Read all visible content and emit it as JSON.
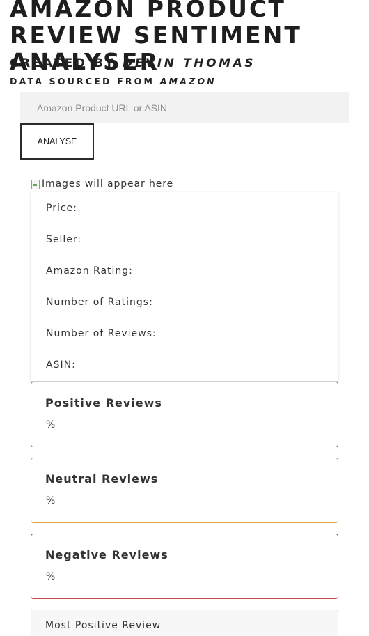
{
  "header": {
    "title": "AMAZON PRODUCT REVIEW SENTIMENT ANALYSER",
    "created_prefix": "CREATED BY ",
    "author": "DEVIN THOMAS",
    "sourced_prefix": "DATA SOURCED FROM ",
    "source": "AMAZON"
  },
  "search": {
    "placeholder": "Amazon Product URL or ASIN",
    "value": "",
    "button_label": "ANALYSE"
  },
  "image": {
    "alt_text": "Images will appear here",
    "icon": "broken-image-icon"
  },
  "product_info": {
    "price_label": "Price:",
    "seller_label": "Seller:",
    "rating_label": "Amazon Rating:",
    "num_ratings_label": "Number of Ratings:",
    "num_reviews_label": "Number of Reviews:",
    "asin_label": "ASIN:"
  },
  "sentiment": {
    "positive": {
      "title": "Positive Reviews",
      "value": "%",
      "color": "#4caf7c"
    },
    "neutral": {
      "title": "Neutral Reviews",
      "value": "%",
      "color": "#e0a43c"
    },
    "negative": {
      "title": "Negative Reviews",
      "value": "%",
      "color": "#c9454a"
    }
  },
  "reviews": {
    "most_positive_title": "Most Positive Review"
  }
}
